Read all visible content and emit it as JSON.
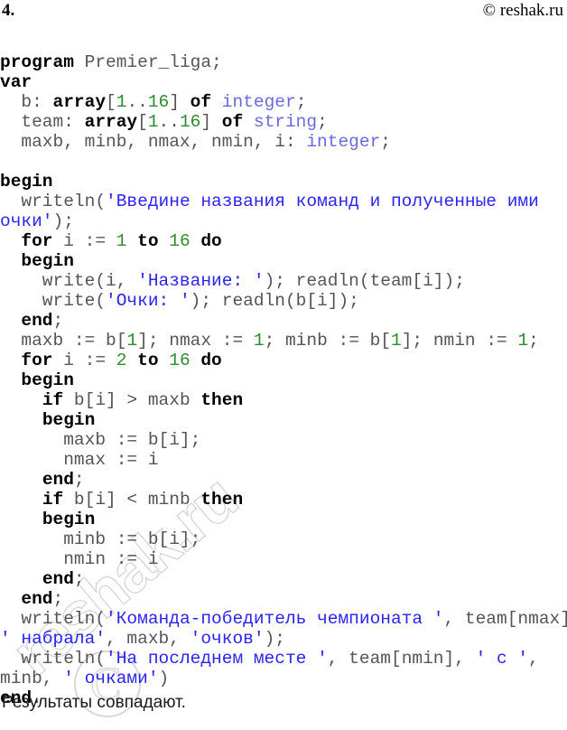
{
  "header": {
    "task_number": "4.",
    "site_credit": "© reshak.ru"
  },
  "watermark": {
    "text": "reshak.ru",
    "symbol": "©"
  },
  "note": {
    "text": "Результаты совпадают."
  },
  "code": {
    "language": "Pascal",
    "lines": [
      {
        "id": "line-01",
        "tokens": [
          {
            "t": "program",
            "c": "kw"
          },
          {
            "t": " Premier_liga;",
            "c": "id"
          }
        ]
      },
      {
        "id": "line-02",
        "tokens": [
          {
            "t": "var",
            "c": "kw"
          }
        ]
      },
      {
        "id": "line-03",
        "tokens": [
          {
            "t": "  b: ",
            "c": "id"
          },
          {
            "t": "array",
            "c": "kw"
          },
          {
            "t": "[",
            "c": "punc"
          },
          {
            "t": "1",
            "c": "num"
          },
          {
            "t": "..",
            "c": "punc"
          },
          {
            "t": "16",
            "c": "num"
          },
          {
            "t": "] ",
            "c": "punc"
          },
          {
            "t": "of",
            "c": "kw"
          },
          {
            "t": " ",
            "c": "id"
          },
          {
            "t": "integer",
            "c": "type"
          },
          {
            "t": ";",
            "c": "punc"
          }
        ]
      },
      {
        "id": "line-04",
        "tokens": [
          {
            "t": "  team: ",
            "c": "id"
          },
          {
            "t": "array",
            "c": "kw"
          },
          {
            "t": "[",
            "c": "punc"
          },
          {
            "t": "1",
            "c": "num"
          },
          {
            "t": "..",
            "c": "punc"
          },
          {
            "t": "16",
            "c": "num"
          },
          {
            "t": "] ",
            "c": "punc"
          },
          {
            "t": "of",
            "c": "kw"
          },
          {
            "t": " ",
            "c": "id"
          },
          {
            "t": "string",
            "c": "type"
          },
          {
            "t": ";",
            "c": "punc"
          }
        ]
      },
      {
        "id": "line-05",
        "tokens": [
          {
            "t": "  maxb, minb, nmax, nmin, i: ",
            "c": "id"
          },
          {
            "t": "integer",
            "c": "type"
          },
          {
            "t": ";",
            "c": "punc"
          }
        ]
      },
      {
        "id": "line-06",
        "tokens": []
      },
      {
        "id": "line-07",
        "tokens": [
          {
            "t": "begin",
            "c": "kw"
          }
        ]
      },
      {
        "id": "line-08",
        "tokens": [
          {
            "t": "  writeln(",
            "c": "id"
          },
          {
            "t": "'Введине названия команд и полученные ими",
            "c": "str"
          }
        ]
      },
      {
        "id": "line-09",
        "tokens": [
          {
            "t": "очки'",
            "c": "str"
          },
          {
            "t": ");",
            "c": "id"
          }
        ]
      },
      {
        "id": "line-10",
        "tokens": [
          {
            "t": "  ",
            "c": "id"
          },
          {
            "t": "for",
            "c": "kw"
          },
          {
            "t": " i := ",
            "c": "id"
          },
          {
            "t": "1",
            "c": "num"
          },
          {
            "t": " ",
            "c": "id"
          },
          {
            "t": "to",
            "c": "kw"
          },
          {
            "t": " ",
            "c": "id"
          },
          {
            "t": "16",
            "c": "num"
          },
          {
            "t": " ",
            "c": "id"
          },
          {
            "t": "do",
            "c": "kw"
          }
        ]
      },
      {
        "id": "line-11",
        "tokens": [
          {
            "t": "  ",
            "c": "id"
          },
          {
            "t": "begin",
            "c": "kw"
          }
        ]
      },
      {
        "id": "line-12",
        "tokens": [
          {
            "t": "    write(i, ",
            "c": "id"
          },
          {
            "t": "'Название: '",
            "c": "str"
          },
          {
            "t": "); readln(team[i]);",
            "c": "id"
          }
        ]
      },
      {
        "id": "line-13",
        "tokens": [
          {
            "t": "    write(",
            "c": "id"
          },
          {
            "t": "'Очки: '",
            "c": "str"
          },
          {
            "t": "); readln(b[i]);",
            "c": "id"
          }
        ]
      },
      {
        "id": "line-14",
        "tokens": [
          {
            "t": "  ",
            "c": "id"
          },
          {
            "t": "end",
            "c": "kw"
          },
          {
            "t": ";",
            "c": "id"
          }
        ]
      },
      {
        "id": "line-15",
        "tokens": [
          {
            "t": "  maxb := b[",
            "c": "id"
          },
          {
            "t": "1",
            "c": "num"
          },
          {
            "t": "]; nmax := ",
            "c": "id"
          },
          {
            "t": "1",
            "c": "num"
          },
          {
            "t": "; minb := b[",
            "c": "id"
          },
          {
            "t": "1",
            "c": "num"
          },
          {
            "t": "]; nmin := ",
            "c": "id"
          },
          {
            "t": "1",
            "c": "num"
          },
          {
            "t": ";",
            "c": "id"
          }
        ]
      },
      {
        "id": "line-16",
        "tokens": [
          {
            "t": "  ",
            "c": "id"
          },
          {
            "t": "for",
            "c": "kw"
          },
          {
            "t": " i := ",
            "c": "id"
          },
          {
            "t": "2",
            "c": "num"
          },
          {
            "t": " ",
            "c": "id"
          },
          {
            "t": "to",
            "c": "kw"
          },
          {
            "t": " ",
            "c": "id"
          },
          {
            "t": "16",
            "c": "num"
          },
          {
            "t": " ",
            "c": "id"
          },
          {
            "t": "do",
            "c": "kw"
          }
        ]
      },
      {
        "id": "line-17",
        "tokens": [
          {
            "t": "  ",
            "c": "id"
          },
          {
            "t": "begin",
            "c": "kw"
          }
        ]
      },
      {
        "id": "line-18",
        "tokens": [
          {
            "t": "    ",
            "c": "id"
          },
          {
            "t": "if",
            "c": "kw"
          },
          {
            "t": " b[i] > maxb ",
            "c": "id"
          },
          {
            "t": "then",
            "c": "kw"
          }
        ]
      },
      {
        "id": "line-19",
        "tokens": [
          {
            "t": "    ",
            "c": "id"
          },
          {
            "t": "begin",
            "c": "kw"
          }
        ]
      },
      {
        "id": "line-20",
        "tokens": [
          {
            "t": "      maxb := b[i];",
            "c": "id"
          }
        ]
      },
      {
        "id": "line-21",
        "tokens": [
          {
            "t": "      nmax := i",
            "c": "id"
          }
        ]
      },
      {
        "id": "line-22",
        "tokens": [
          {
            "t": "    ",
            "c": "id"
          },
          {
            "t": "end",
            "c": "kw"
          },
          {
            "t": ";",
            "c": "id"
          }
        ]
      },
      {
        "id": "line-23",
        "tokens": [
          {
            "t": "    ",
            "c": "id"
          },
          {
            "t": "if",
            "c": "kw"
          },
          {
            "t": " b[i] < minb ",
            "c": "id"
          },
          {
            "t": "then",
            "c": "kw"
          }
        ]
      },
      {
        "id": "line-24",
        "tokens": [
          {
            "t": "    ",
            "c": "id"
          },
          {
            "t": "begin",
            "c": "kw"
          }
        ]
      },
      {
        "id": "line-25",
        "tokens": [
          {
            "t": "      minb := b[i];",
            "c": "id"
          }
        ]
      },
      {
        "id": "line-26",
        "tokens": [
          {
            "t": "      nmin := i",
            "c": "id"
          }
        ]
      },
      {
        "id": "line-27",
        "tokens": [
          {
            "t": "    ",
            "c": "id"
          },
          {
            "t": "end",
            "c": "kw"
          },
          {
            "t": ";",
            "c": "id"
          }
        ]
      },
      {
        "id": "line-28",
        "tokens": [
          {
            "t": "  ",
            "c": "id"
          },
          {
            "t": "end",
            "c": "kw"
          },
          {
            "t": ";",
            "c": "id"
          }
        ]
      },
      {
        "id": "line-29",
        "tokens": [
          {
            "t": "  writeln(",
            "c": "id"
          },
          {
            "t": "'Команда-победитель чемпионата '",
            "c": "str"
          },
          {
            "t": ", team[nmax],",
            "c": "id"
          }
        ]
      },
      {
        "id": "line-30",
        "tokens": [
          {
            "t": "' набрала'",
            "c": "str"
          },
          {
            "t": ", maxb, ",
            "c": "id"
          },
          {
            "t": "'очков'",
            "c": "str"
          },
          {
            "t": ");",
            "c": "id"
          }
        ]
      },
      {
        "id": "line-31",
        "tokens": [
          {
            "t": "  writeln(",
            "c": "id"
          },
          {
            "t": "'На последнем месте '",
            "c": "str"
          },
          {
            "t": ", team[nmin], ",
            "c": "id"
          },
          {
            "t": "' с '",
            "c": "str"
          },
          {
            "t": ",",
            "c": "id"
          }
        ]
      },
      {
        "id": "line-32",
        "tokens": [
          {
            "t": "minb, ",
            "c": "id"
          },
          {
            "t": "' очками'",
            "c": "str"
          },
          {
            "t": ")",
            "c": "id"
          }
        ]
      },
      {
        "id": "line-33",
        "tokens": [
          {
            "t": "end",
            "c": "kw"
          },
          {
            "t": ".",
            "c": "id"
          }
        ]
      }
    ]
  }
}
